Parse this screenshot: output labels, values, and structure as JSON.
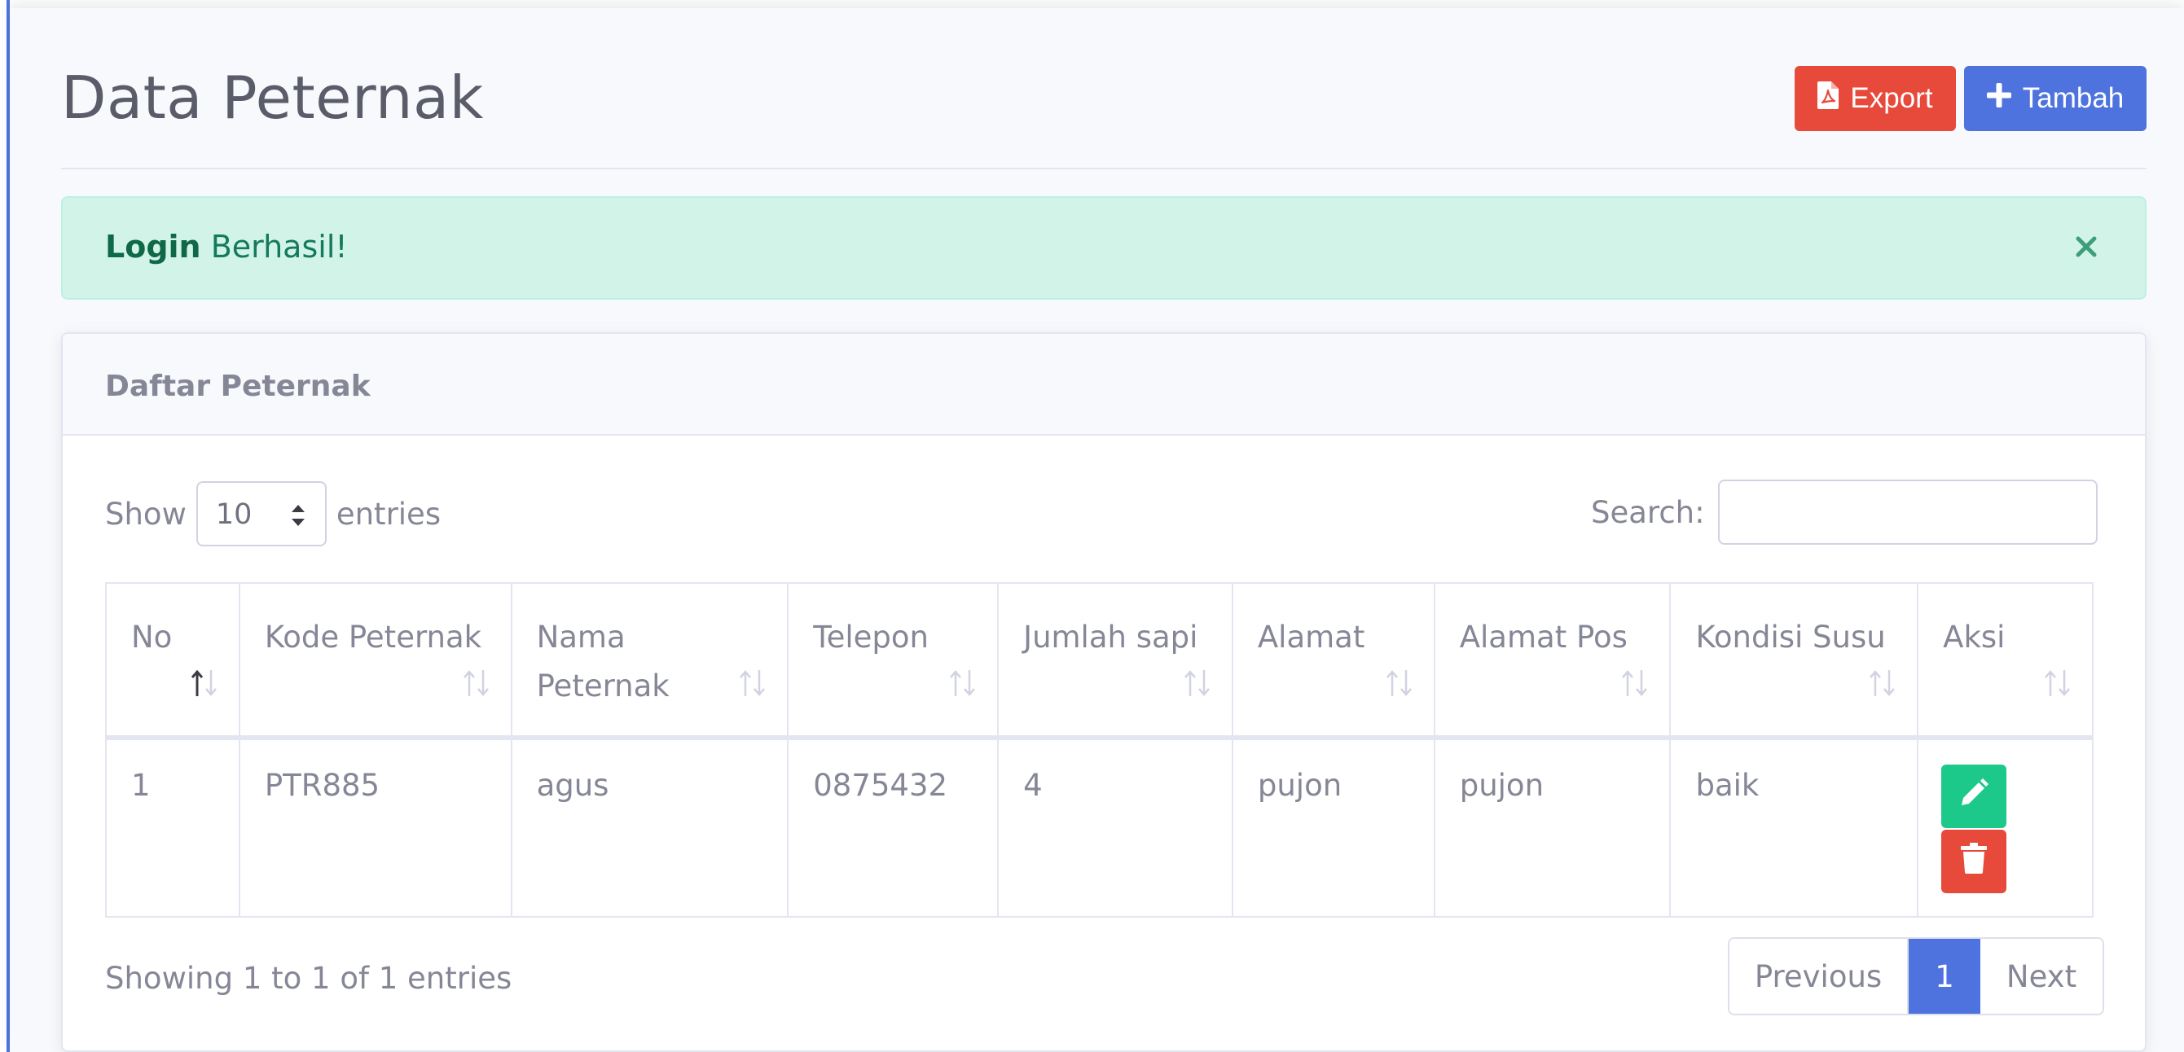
{
  "page": {
    "title": "Data Peternak",
    "export_label": "Export",
    "tambah_label": "Tambah"
  },
  "alert": {
    "strong": "Login",
    "message": " Berhasil!"
  },
  "card": {
    "title": "Daftar Peternak",
    "show_label": "Show",
    "entries_label": "entries",
    "page_length": "10",
    "search_label": "Search:",
    "search_value": "",
    "columns": [
      "No",
      "Kode Peternak",
      "Nama Peternak",
      "Telepon",
      "Jumlah sapi",
      "Alamat",
      "Alamat Pos",
      "Kondisi Susu",
      "Aksi"
    ],
    "rows": [
      {
        "no": "1",
        "kode": "PTR885",
        "nama": "agus",
        "telepon": "0875432",
        "jumlah": "4",
        "alamat": "pujon",
        "alamat_pos": "pujon",
        "kondisi": "baik"
      }
    ],
    "info": "Showing 1 to 1 of 1 entries",
    "pagination": {
      "previous": "Previous",
      "current": "1",
      "next": "Next"
    }
  },
  "colors": {
    "primary": "#4e73df",
    "danger": "#e74a3b",
    "success": "#1cc88a",
    "alert_bg": "#d2f4e8"
  },
  "icons": {
    "export": "file-pdf-icon",
    "tambah": "plus-icon",
    "close": "close-icon",
    "sort": "sort-icon",
    "edit": "pencil-icon",
    "delete": "trash-icon"
  }
}
